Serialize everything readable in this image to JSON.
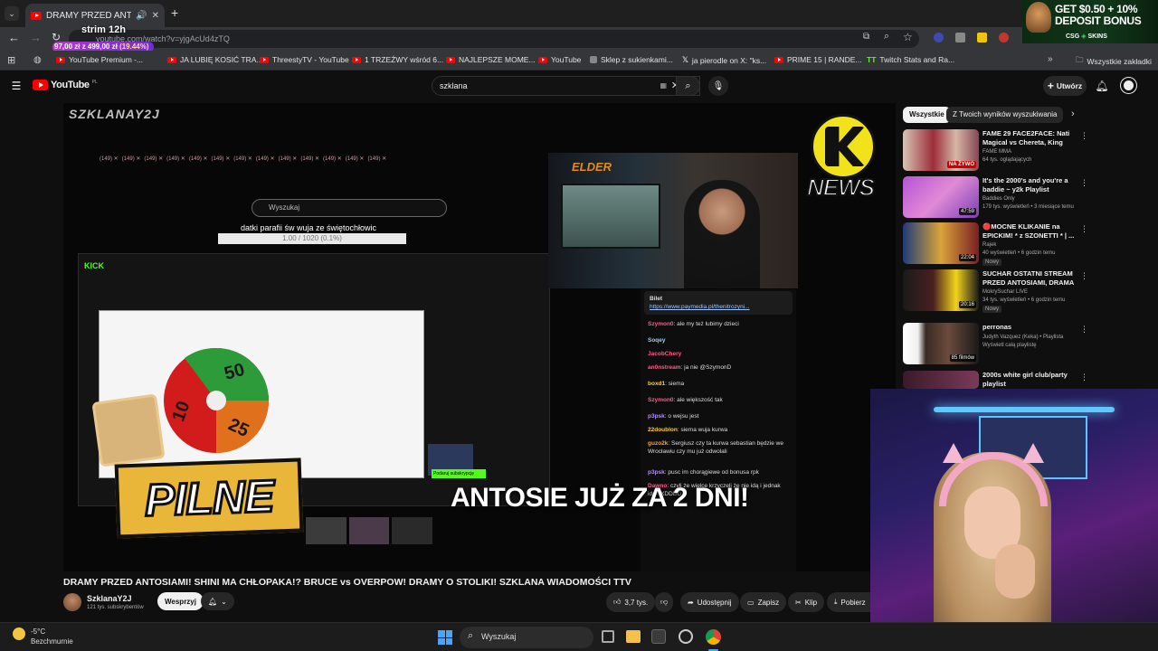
{
  "browser": {
    "tab_title": "DRAMY PRZED ANTOSIAMI",
    "new_tab_symbol": "+",
    "url": "youtube.com/watch?v=yjgAcUd4zTQ",
    "overlay_title": "strim 12h",
    "overlay_progress": "97,00 zł z 499,00 zł",
    "overlay_percent": "(19.44%)",
    "bookmarks": [
      {
        "label": "YouTube Premium -...",
        "icon": "youtube-icon"
      },
      {
        "label": "JA LUBIĘ KOSIĆ TRA...",
        "icon": "youtube-icon"
      },
      {
        "label": "ThreestyTV - YouTube",
        "icon": "youtube-icon"
      },
      {
        "label": "1 TRZEŹWY wśród 6...",
        "icon": "youtube-icon"
      },
      {
        "label": "NAJLEPSZE MOME...",
        "icon": "youtube-icon"
      },
      {
        "label": "YouTube",
        "icon": "youtube-icon"
      },
      {
        "label": "Sklep z sukienkami...",
        "icon": "shop-icon"
      },
      {
        "label": "ja pierodle on X: \"ks...",
        "icon": "x-icon"
      },
      {
        "label": "PRIME 15 | RANDE...",
        "icon": "youtube-icon"
      },
      {
        "label": "Twitch Stats and Ra...",
        "icon": "tt-icon"
      }
    ],
    "all_bookmarks": "Wszystkie zakładki"
  },
  "ad": {
    "line1": "GET $0.50 + 10%",
    "line2": "DEPOSIT BONUS",
    "brand": "CSG",
    "brand2": "SKINS"
  },
  "youtube": {
    "logo_text": "YouTube",
    "region": "PL",
    "search_value": "szklana",
    "create_label": "Utwórz"
  },
  "video": {
    "watermark": "SZKLANAY2J",
    "news_badge": "NEWS",
    "pilne": "PILNE",
    "caption": "ANTOSIE JUŻ ZA 2 DNI!",
    "inner_search": "Wyszukaj",
    "inner_donation_title": "datki parafii św wuja ze świętochłowic",
    "inner_donation_value": "1.00 / 1020 (0.1%)",
    "elder_label": "ELDER",
    "kick_label": "KICK",
    "wheel": {
      "a": "50",
      "b": "25",
      "c": "10"
    },
    "chat_pinned": "Bilet",
    "chat_link": "https://www.paymedia.pl/thenitrozyni...",
    "chat": [
      {
        "user": "Szymon0",
        "text": "ale my też lubimy dzieci",
        "color": "#ff5c8a"
      },
      {
        "user": "Soqey",
        "text": "",
        "color": "#9ecbff"
      },
      {
        "user": "JacobChery",
        "text": "",
        "color": "#ff5c8a"
      },
      {
        "user": "an0nstream",
        "text": "ja nie @SzymonD",
        "color": "#ff5c8a"
      },
      {
        "user": "boxd1",
        "text": "siema",
        "color": "#ffcf3a"
      },
      {
        "user": "Szymon0",
        "text": "ale większość tak",
        "color": "#ff5c8a"
      },
      {
        "user": "p3psk",
        "text": "o wejsu jest",
        "color": "#b48cff"
      },
      {
        "user": "22doublon",
        "text": "siema wuja kurwa",
        "color": "#ffcf3a"
      },
      {
        "user": "guzo2k",
        "text": "Sergiusz czy ta kurwa sebastian będzie we Wrocławiu czy mu już odwolali",
        "color": "#ff9f43"
      },
      {
        "user": "p3psk",
        "text": "pusc im chorągiewe od bonusa rpk",
        "color": "#b48cff"
      },
      {
        "user": "Dawno",
        "text": "czyli że wielce krzyczeli że nie idą i jednak idą? XDDDD",
        "color": "#ff5c8a"
      }
    ],
    "title": "DRAMY PRZED ANTOSIAMI! SHINI MA CHŁOPAKA!? BRUCE vs OVERPOW! DRAMY O STOLIKI! SZKLANA WIADOMOŚCI TTV"
  },
  "channel": {
    "name": "SzklanaY2J",
    "subs": "121 tys. subskrybentów",
    "support": "Wesprzyj",
    "likes": "3,7 tys.",
    "share": "Udostępnij",
    "save": "Zapisz",
    "clip": "Klip",
    "download": "Pobierz"
  },
  "sidebar": {
    "chips": [
      "Wszystkie",
      "Z Twoich wyników wyszukiwania"
    ],
    "items": [
      {
        "title": "FAME 29 FACE2FACE: Nati Magical vs Chereta, King Kong...",
        "channel": "FAME MMA",
        "meta": "64 tys. oglądających",
        "badge": "NA ŻYWO"
      },
      {
        "title": "It's the 2000's and you're a baddie ~ y2k Playlist",
        "channel": "Baddies Only",
        "meta": "179 tys. wyświetleń • 3 miesiące temu",
        "badge": "47:59"
      },
      {
        "title": "🔴MOCNE KLIKANIE na EPICKIM! * z SZONETTI * | ...",
        "channel": "Rajek",
        "meta": "40 wyświetleń • 6 godzin temu",
        "badge": "22:04",
        "tag": "Nowy"
      },
      {
        "title": "SUCHAR OSTATNI STREAM PRZED ANTOSIAMI, DRAMA ...",
        "channel": "MokrySuchar LIVE",
        "meta": "34 tys. wyświetleń • 6 godzin temu",
        "badge": "20:16",
        "tag": "Nowy"
      },
      {
        "title": "perronas",
        "channel": "Judyth Vazquez (Keka) • Playlista",
        "meta": "Wyświetl całą playlistę",
        "badge": "85 filmów"
      },
      {
        "title": "2000s white girl club/party playlist",
        "channel": "",
        "meta": "",
        "badge": ""
      }
    ]
  },
  "taskbar": {
    "temp": "-5°C",
    "weather": "Bezchmurnie",
    "search": "Wyszukaj"
  },
  "colors": {
    "yt_red": "#ff0000",
    "accent_green": "#53fc18",
    "pilne_gold": "#e9b63a"
  }
}
